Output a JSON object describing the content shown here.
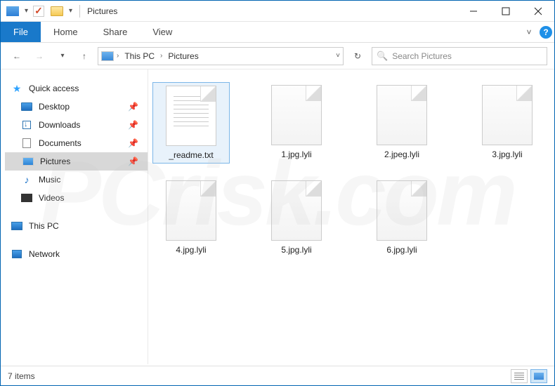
{
  "window": {
    "title": "Pictures"
  },
  "ribbon": {
    "file": "File",
    "tabs": [
      "Home",
      "Share",
      "View"
    ]
  },
  "address": {
    "crumbs": [
      "This PC",
      "Pictures"
    ]
  },
  "search": {
    "placeholder": "Search Pictures"
  },
  "sidebar": {
    "quick_access": "Quick access",
    "items": [
      {
        "label": "Desktop",
        "pinned": true
      },
      {
        "label": "Downloads",
        "pinned": true
      },
      {
        "label": "Documents",
        "pinned": true
      },
      {
        "label": "Pictures",
        "pinned": true,
        "selected": true
      },
      {
        "label": "Music",
        "pinned": false
      },
      {
        "label": "Videos",
        "pinned": false
      }
    ],
    "this_pc": "This PC",
    "network": "Network"
  },
  "files": [
    {
      "name": "_readme.txt",
      "kind": "text",
      "selected": true
    },
    {
      "name": "1.jpg.lyli",
      "kind": "generic"
    },
    {
      "name": "2.jpeg.lyli",
      "kind": "generic"
    },
    {
      "name": "3.jpg.lyli",
      "kind": "generic"
    },
    {
      "name": "4.jpg.lyli",
      "kind": "generic"
    },
    {
      "name": "5.jpg.lyli",
      "kind": "generic"
    },
    {
      "name": "6.jpg.lyli",
      "kind": "generic"
    }
  ],
  "statusbar": {
    "count_label": "7 items"
  },
  "icons": {
    "pin": "📌",
    "search": "🔍",
    "help": "?"
  }
}
